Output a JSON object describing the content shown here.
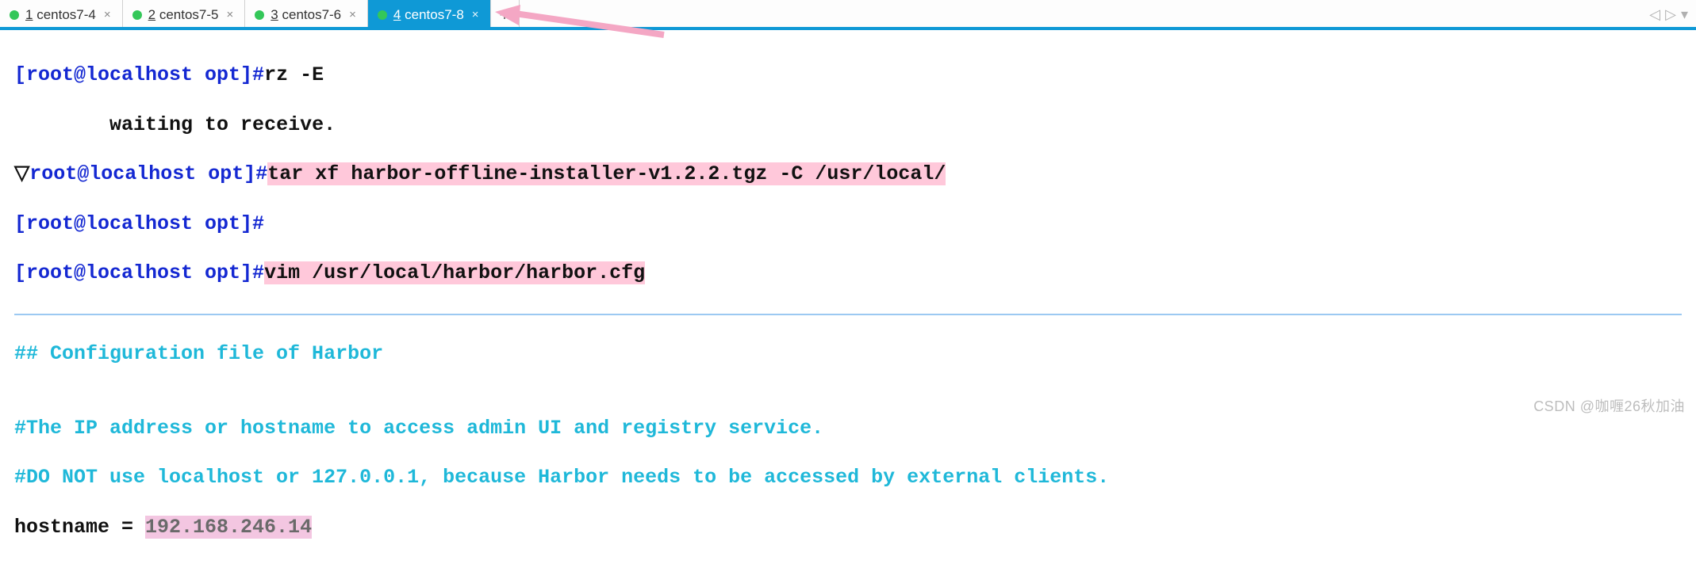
{
  "tabs": [
    {
      "num": "1",
      "name": "centos7-4",
      "active": false
    },
    {
      "num": "2",
      "name": "centos7-5",
      "active": false
    },
    {
      "num": "3",
      "name": "centos7-6",
      "active": false
    },
    {
      "num": "4",
      "name": "centos7-8",
      "active": true
    }
  ],
  "newtab_label": "+",
  "nav": {
    "left": "◁",
    "right": "▷",
    "menu": "▾"
  },
  "terminal": {
    "prompt1": "[root@localhost opt]#",
    "cmd1": "rz -E",
    "waiting": "\twaiting to receive.",
    "triangle": "▽",
    "prompt2": "root@localhost opt]#",
    "cmd2": "tar xf harbor-offline-installer-v1.2.2.tgz -C /usr/local/",
    "prompt3": "[root@localhost opt]#",
    "prompt4": "[root@localhost opt]#",
    "cmd4": "vim /usr/local/harbor/harbor.cfg",
    "cfg_header": "## Configuration file of Harbor",
    "blank": "",
    "cfg_c1": "#The IP address or hostname to access admin UI and registry service.",
    "cfg_c2": "#DO NOT use localhost or 127.0.0.1, because Harbor needs to be accessed by external clients.",
    "hostname_key": "hostname = ",
    "hostname_val": "192.168.246.14"
  },
  "watermark": "CSDN @咖喱26秋加油"
}
